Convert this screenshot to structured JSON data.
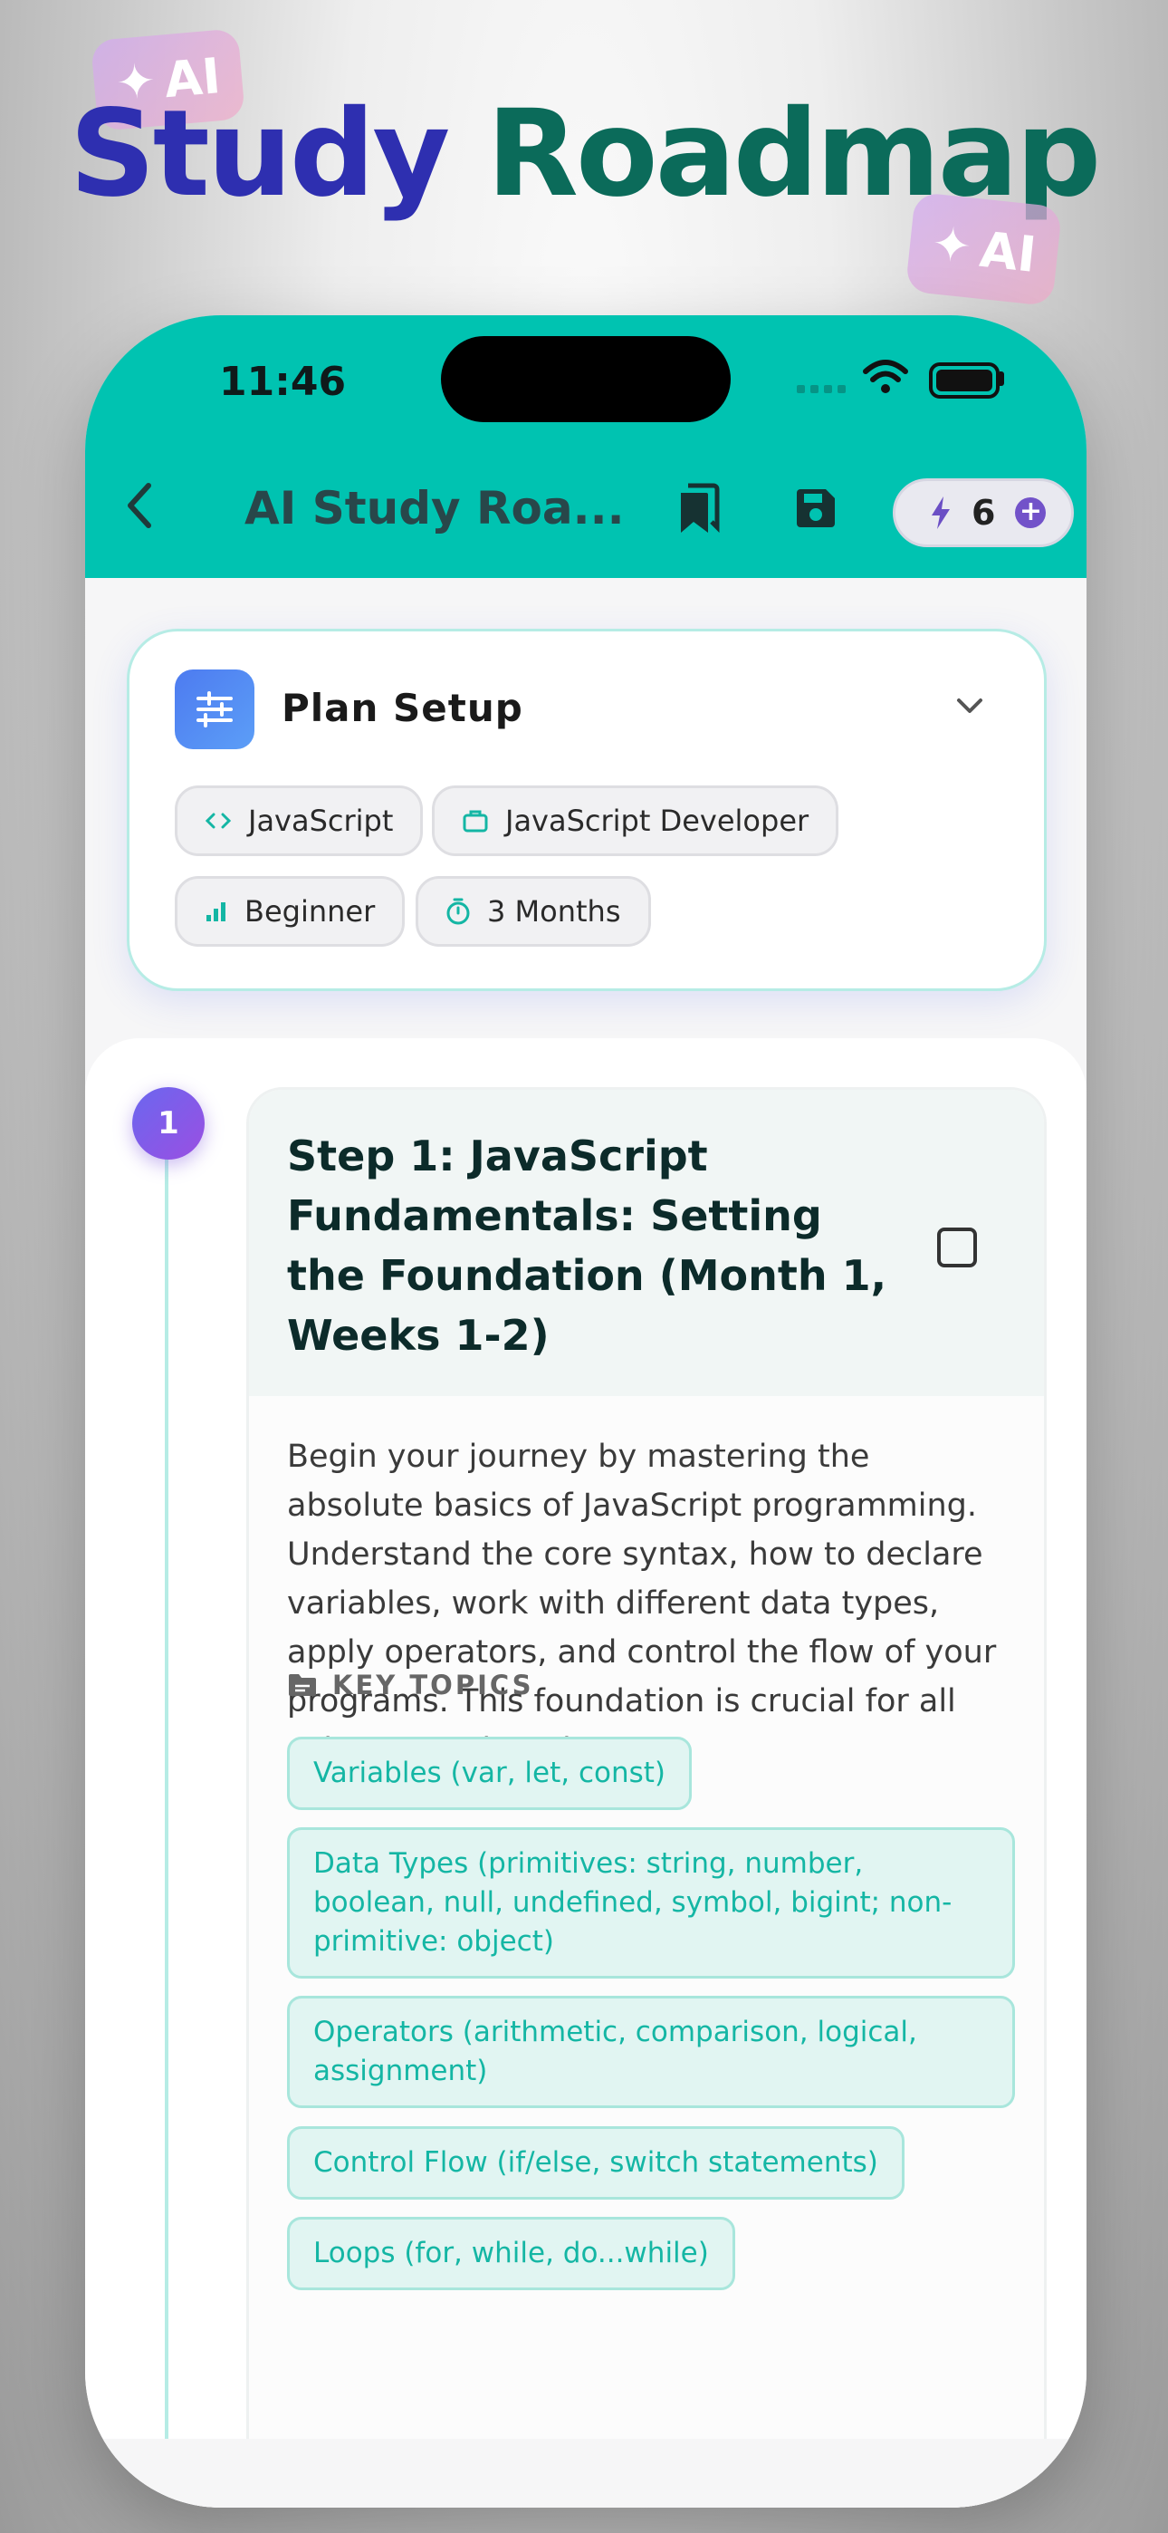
{
  "headline": {
    "word1": "Study",
    "word2": "Roadmap"
  },
  "badges": [
    {
      "label": "AI",
      "icon": "sparkle-icon"
    },
    {
      "label": "AI",
      "icon": "sparkle-icon"
    }
  ],
  "status_bar": {
    "time": "11:46"
  },
  "nav": {
    "title": "AI Study Roa...",
    "credits": "6",
    "icons": [
      "back-chevron-icon",
      "bookmarks-icon",
      "save-icon",
      "bolt-icon",
      "plus-icon"
    ]
  },
  "setup": {
    "title": "Plan Setup",
    "chips": [
      {
        "icon": "code-icon",
        "label": "JavaScript"
      },
      {
        "icon": "briefcase-icon",
        "label": "JavaScript Developer"
      },
      {
        "icon": "level-bars-icon",
        "label": "Beginner"
      },
      {
        "icon": "timer-icon",
        "label": "3 Months"
      }
    ]
  },
  "step": {
    "number": "1",
    "title": "Step 1: JavaScript Fundamentals: Setting the Foundation (Month 1, Weeks 1-2)",
    "description": "Begin your journey by mastering the absolute basics of JavaScript programming. Understand the core syntax, how to declare variables, work with different data types, apply operators, and control the flow of your programs. This foundation is crucial for all subsequent learning.",
    "topics_label": "KEY TOPICS",
    "topics": [
      "Variables (var, let, const)",
      "Data Types (primitives: string, number, boolean, null, undefined, symbol, bigint; non-primitive: object)",
      "Operators (arithmetic, comparison, logical, assignment)",
      "Control Flow (if/else, switch statements)",
      "Loops (for, while, do...while)"
    ]
  },
  "colors": {
    "accent": "#00c3b1",
    "topic_text": "#14b6a4",
    "step_badge": "#7b5be8"
  }
}
